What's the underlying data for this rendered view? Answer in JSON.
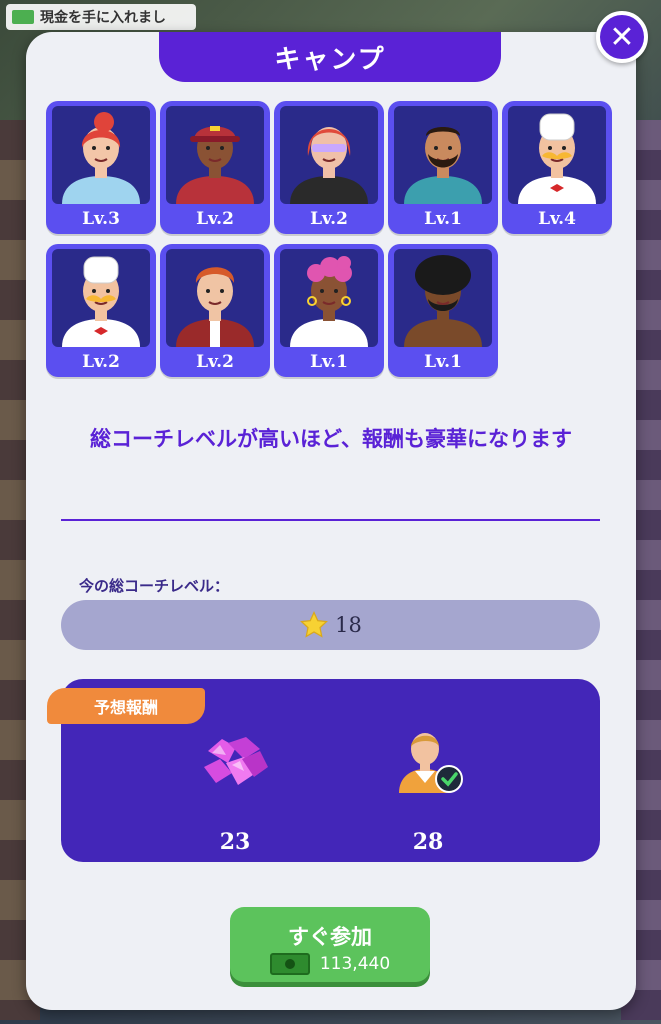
{
  "background": {
    "notification_text": "現金を手に入れまし"
  },
  "dialog": {
    "title": "キャンプ",
    "close_icon": "close-icon"
  },
  "coaches": [
    {
      "level": "Lv.3",
      "hair": "#e0443a",
      "skin": "#f3c6a8",
      "shirt": "#9fd4ef",
      "style": "bun"
    },
    {
      "level": "Lv.2",
      "hair": "#b8323a",
      "skin": "#8a5234",
      "shirt": "#b8323a",
      "style": "cap"
    },
    {
      "level": "Lv.2",
      "hair": "#e04a3a",
      "skin": "#f0c0a8",
      "shirt": "#2a2a2a",
      "style": "visor"
    },
    {
      "level": "Lv.1",
      "hair": "#2a1a10",
      "skin": "#c98a5e",
      "shirt": "#3c9fae",
      "style": "beard"
    },
    {
      "level": "Lv.4",
      "hair": "#ffffff",
      "skin": "#f2c2a0",
      "shirt": "#ffffff",
      "style": "chef"
    },
    {
      "level": "Lv.2",
      "hair": "#ffffff",
      "skin": "#f2c2a0",
      "shirt": "#ffffff",
      "style": "chef"
    },
    {
      "level": "Lv.2",
      "hair": "#d65a2a",
      "skin": "#f0c4a4",
      "shirt": "#9a2a2a",
      "style": "vest"
    },
    {
      "level": "Lv.1",
      "hair": "#e055b0",
      "skin": "#8a5234",
      "shirt": "#ffffff",
      "style": "curly"
    },
    {
      "level": "Lv.1",
      "hair": "#1a1a1a",
      "skin": "#7a4a2a",
      "shirt": "#7a4a2a",
      "style": "afro"
    }
  ],
  "description": "総コーチレベルが高いほど、報酬も豪華になります",
  "total_level": {
    "label": "今の総コーチレベル：",
    "value": "18",
    "icon": "star-icon"
  },
  "rewards": {
    "tag": "予想報酬",
    "gems": {
      "icon": "gem-icon",
      "value": "23"
    },
    "fans": {
      "icon": "fan-check-icon",
      "value": "28"
    }
  },
  "join_button": {
    "label": "すぐ参加",
    "cost": "113,440",
    "cost_icon": "cash-icon"
  },
  "colors": {
    "primary": "#5a22d6",
    "panel": "#eef0f5",
    "reward_bg": "#4326b8",
    "tag": "#f08a3c",
    "button": "#5cc35c"
  }
}
